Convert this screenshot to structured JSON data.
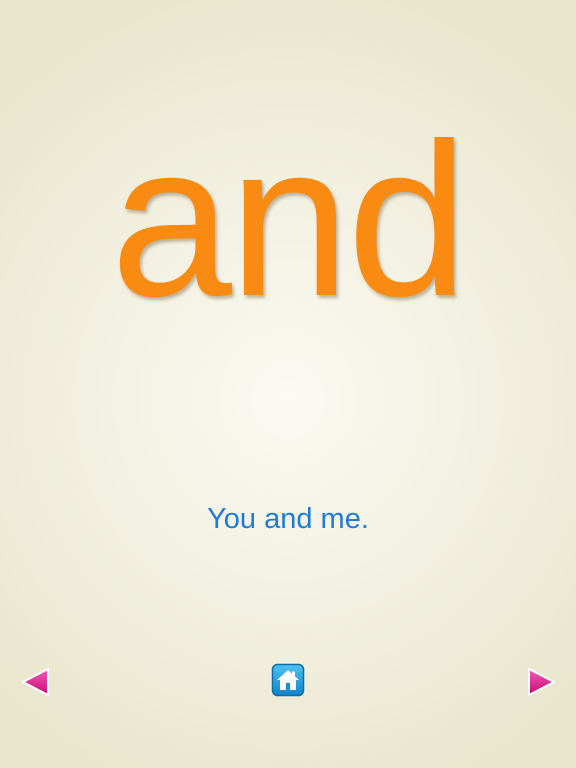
{
  "flashcard": {
    "word": "and",
    "sentence": "You and me."
  },
  "navigation": {
    "previous_icon": "left-triangle-arrow",
    "home_icon": "house",
    "next_icon": "right-triangle-arrow"
  },
  "colors": {
    "word": "#f98a12",
    "sentence": "#1f7bd8",
    "arrow": "#e3158c",
    "home_button": "#1fa0e0"
  }
}
